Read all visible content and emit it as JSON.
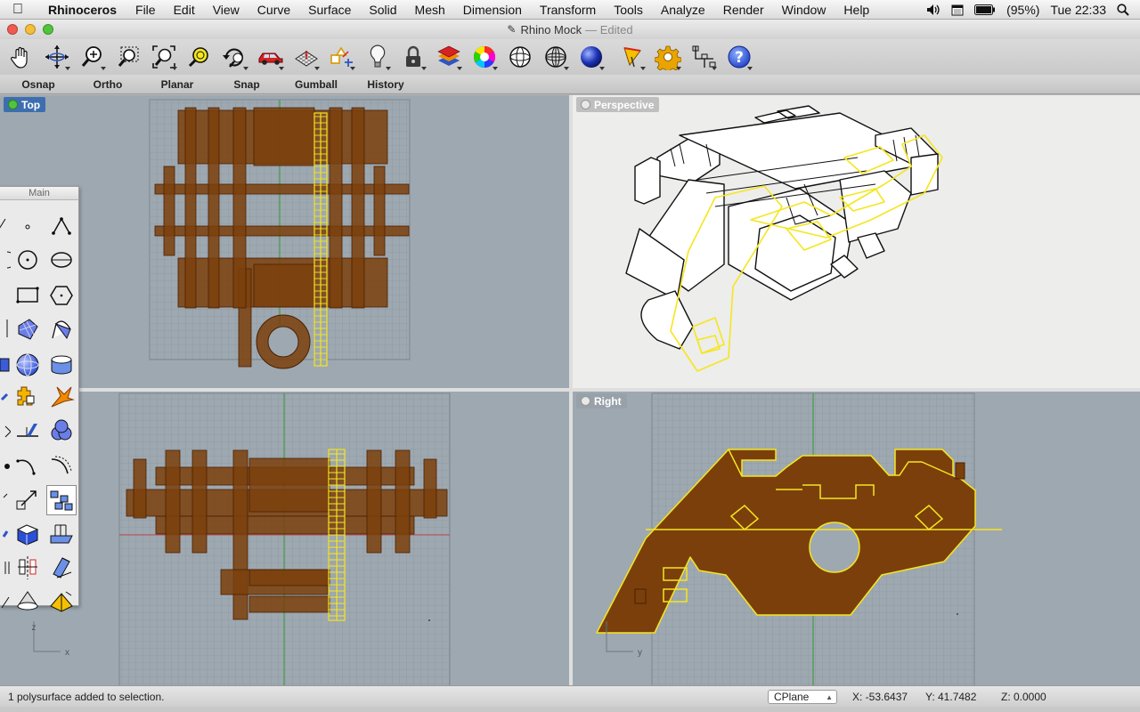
{
  "menubar": {
    "app_name": "Rhinoceros",
    "items": [
      "File",
      "Edit",
      "View",
      "Curve",
      "Surface",
      "Solid",
      "Mesh",
      "Dimension",
      "Transform",
      "Tools",
      "Analyze",
      "Render",
      "Window",
      "Help"
    ],
    "battery": "(95%)",
    "clock": "Tue 22:33"
  },
  "window": {
    "title": "Rhino Mock",
    "status": "— Edited"
  },
  "toolbar": {
    "icons": [
      "pan-icon",
      "rotate-view-icon",
      "zoom-icon",
      "zoom-window-icon",
      "zoom-extents-icon",
      "zoom-selected-icon",
      "undo-view-icon",
      "car-icon",
      "grid-plane-icon",
      "osnap-icon",
      "lightbulb-icon",
      "lock-icon",
      "layer-icon",
      "color-wheel-icon",
      "wireframe-sphere-icon",
      "ghosted-sphere-icon",
      "shaded-sphere-icon",
      "render-icon",
      "gear-icon",
      "align-icon",
      "help-icon"
    ]
  },
  "modes": [
    "Osnap",
    "Ortho",
    "Planar",
    "Snap",
    "Gumball",
    "History"
  ],
  "viewports": {
    "top": "Top",
    "perspective": "Perspective",
    "right": "Right",
    "front_axis": "z  x",
    "right_axis": "z  y"
  },
  "palette": {
    "title": "Main"
  },
  "status": {
    "message": "1 polysurface added to selection.",
    "cplane": "CPlane",
    "x": "X: -53.6437",
    "y": "Y: 41.7482",
    "z": "Z: 0.0000"
  },
  "colors": {
    "object_fill": "#7b3f0c",
    "selected": "#f5e61e",
    "viewport_bg": "#9ea8b1"
  }
}
